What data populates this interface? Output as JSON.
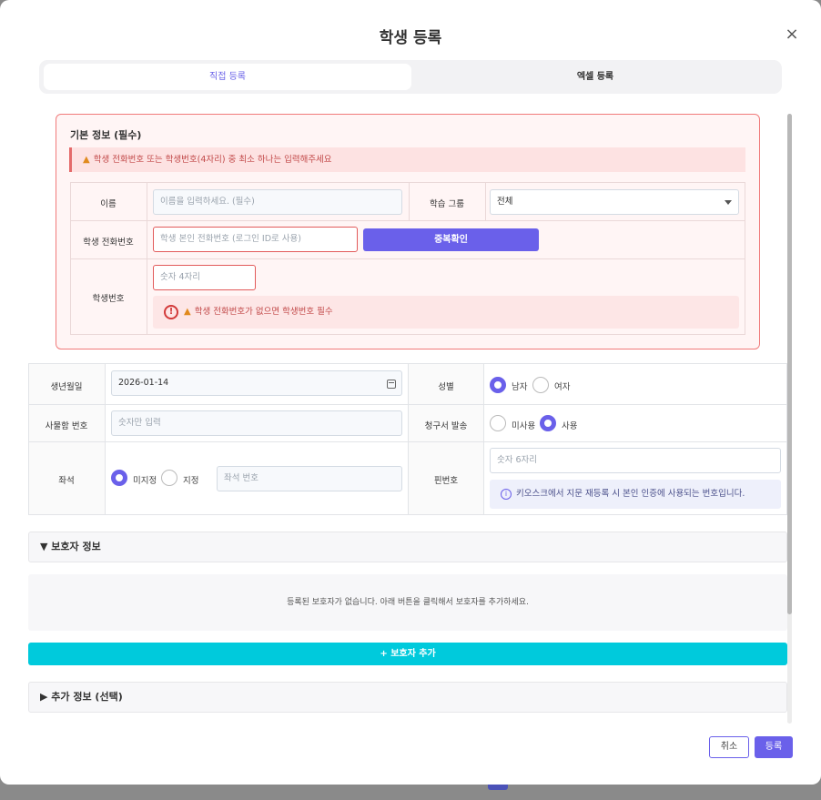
{
  "modal": {
    "title": "학생 등록",
    "close": "×"
  },
  "tabs": [
    {
      "label": "직접 등록",
      "active": true
    },
    {
      "label": "엑셀 등록",
      "active": false
    }
  ],
  "basic": {
    "title": "기본 정보 (필수)",
    "warning": "학생 전화번호 또는 학생번호(4자리) 중 최소 하나는 입력해주세요",
    "name_label": "이름",
    "name_placeholder": "이름을 입력하세요. (필수)",
    "group_label": "학습 그룹",
    "group_value": "전체",
    "phone_label": "학생 전화번호",
    "phone_placeholder": "학생 본인 전화번호 (로그인 ID로 사용)",
    "dup_button": "중복확인",
    "number_label": "학생번호",
    "number_placeholder": "숫자 4자리",
    "number_error": "학생 전화번호가 없으면 학생번호 필수"
  },
  "info": {
    "birth_label": "생년월일",
    "birth_value": "2026-01-14",
    "gender_label": "성별",
    "gender_options": [
      "남자",
      "여자"
    ],
    "gender_selected": "남자",
    "mailbox_label": "사물함 번호",
    "mailbox_placeholder": "숫자만 입력",
    "invoice_label": "청구서 발송",
    "invoice_options": [
      "미사용",
      "사용"
    ],
    "invoice_selected": "사용",
    "seat_label": "좌석",
    "seat_options": [
      "미지정",
      "지정"
    ],
    "seat_selected": "미지정",
    "seat_placeholder": "좌석 번호",
    "pin_label": "핀번호",
    "pin_placeholder": "숫자 6자리",
    "pin_note": "키오스크에서 지문 재등록 시 본인 인증에 사용되는 번호입니다."
  },
  "guardian": {
    "title": "▼ 보호자 정보",
    "empty": "등록된 보호자가 없습니다. 아래 버튼을 클릭해서 보호자를 추가하세요.",
    "add_button": "+ 보호자 추가"
  },
  "extra": {
    "title": "▶ 추가 정보 (선택)"
  },
  "footer": {
    "cancel": "취소",
    "submit": "등록"
  },
  "colors": {
    "accent": "#6a60ea",
    "cyan": "#00cadc",
    "error": "#e25a5a"
  }
}
